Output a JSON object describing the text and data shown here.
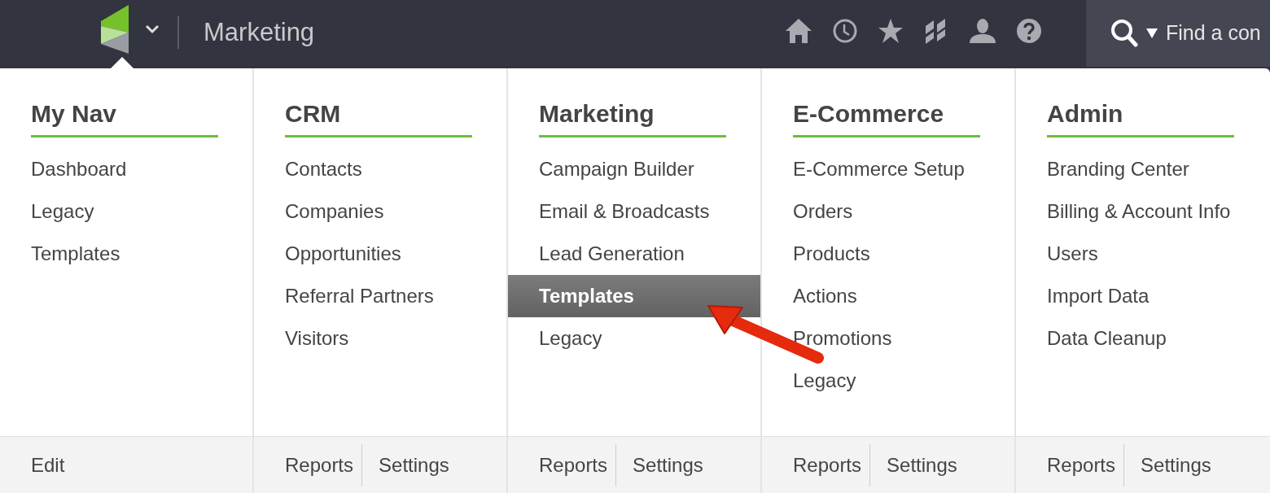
{
  "top_bar": {
    "section_title": "Marketing",
    "search": {
      "placeholder": "Find a con"
    }
  },
  "menu_columns": [
    {
      "heading": "My Nav",
      "items": [
        {
          "label": "Dashboard",
          "selected": false
        },
        {
          "label": "Legacy",
          "selected": false
        },
        {
          "label": "Templates",
          "selected": false
        }
      ],
      "footer_links": [
        "Edit"
      ]
    },
    {
      "heading": "CRM",
      "items": [
        {
          "label": "Contacts",
          "selected": false
        },
        {
          "label": "Companies",
          "selected": false
        },
        {
          "label": "Opportunities",
          "selected": false
        },
        {
          "label": "Referral Partners",
          "selected": false
        },
        {
          "label": "Visitors",
          "selected": false
        }
      ],
      "footer_links": [
        "Reports",
        "Settings"
      ]
    },
    {
      "heading": "Marketing",
      "items": [
        {
          "label": "Campaign Builder",
          "selected": false
        },
        {
          "label": "Email & Broadcasts",
          "selected": false
        },
        {
          "label": "Lead Generation",
          "selected": false
        },
        {
          "label": "Templates",
          "selected": true
        },
        {
          "label": "Legacy",
          "selected": false
        }
      ],
      "footer_links": [
        "Reports",
        "Settings"
      ]
    },
    {
      "heading": "E-Commerce",
      "items": [
        {
          "label": "E-Commerce Setup",
          "selected": false
        },
        {
          "label": "Orders",
          "selected": false
        },
        {
          "label": "Products",
          "selected": false
        },
        {
          "label": "Actions",
          "selected": false
        },
        {
          "label": "Promotions",
          "selected": false
        },
        {
          "label": "Legacy",
          "selected": false
        }
      ],
      "footer_links": [
        "Reports",
        "Settings"
      ]
    },
    {
      "heading": "Admin",
      "items": [
        {
          "label": "Branding Center",
          "selected": false
        },
        {
          "label": "Billing & Account Info",
          "selected": false
        },
        {
          "label": "Users",
          "selected": false
        },
        {
          "label": "Import Data",
          "selected": false
        },
        {
          "label": "Data Cleanup",
          "selected": false
        }
      ],
      "footer_links": [
        "Reports",
        "Settings"
      ]
    }
  ]
}
